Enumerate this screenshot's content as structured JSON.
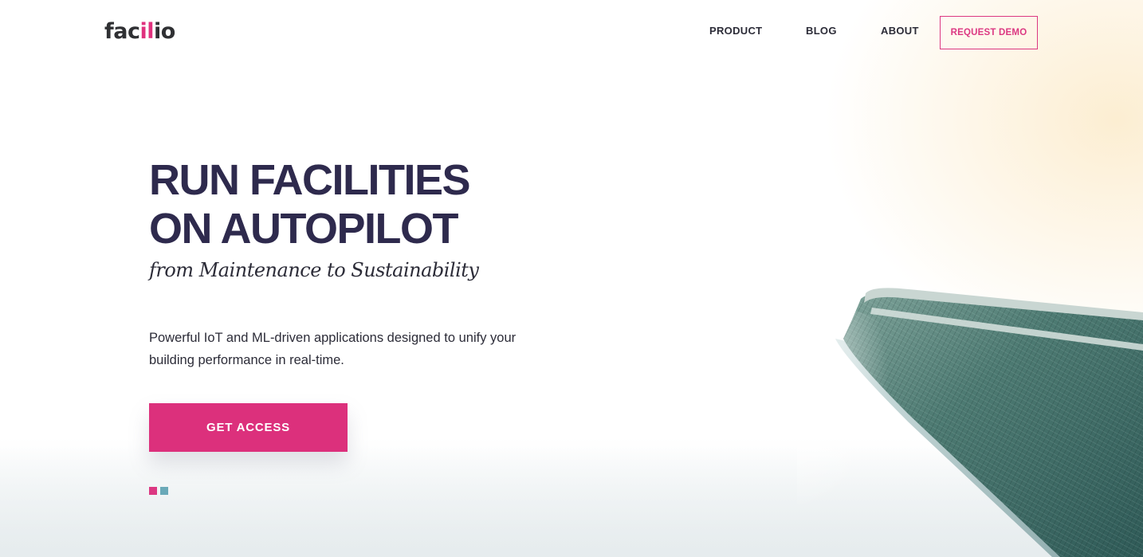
{
  "brand": {
    "logo_text_start": "fac",
    "logo_text_accent": "il",
    "logo_text_end": "io"
  },
  "nav": {
    "items": [
      {
        "label": "PRODUCT"
      },
      {
        "label": "BLOG"
      },
      {
        "label": "ABOUT"
      }
    ],
    "request_demo_label": "REQUEST DEMO"
  },
  "hero": {
    "headline_line1": "RUN FACILITIES",
    "headline_line2": "ON AUTOPILOT",
    "subheadline": "from Maintenance to Sustainability",
    "description": "Powerful IoT and ML-driven applications designed to unify your building performance in real-time.",
    "cta_label": "GET ACCESS"
  },
  "slider": {
    "dots": [
      {
        "color": "#dc3882",
        "active": true
      },
      {
        "color": "#6aa9b8",
        "active": false
      }
    ]
  },
  "colors": {
    "accent": "#dc307c",
    "heading": "#2e2a4d",
    "text": "#2c2c38",
    "secondary": "#6aa9b8"
  },
  "icons": {
    "building_image": "skyscraper-photo"
  }
}
